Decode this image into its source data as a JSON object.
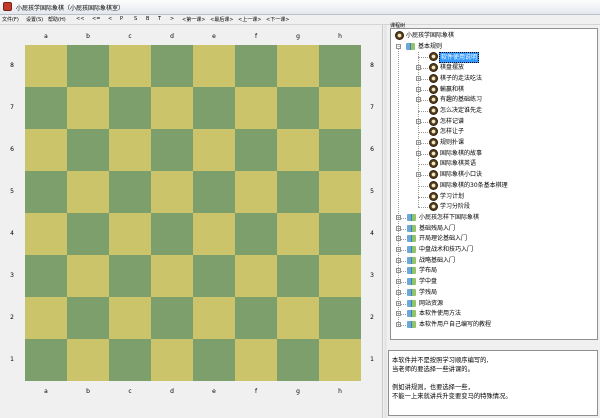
{
  "window": {
    "title": "小屁孩学国际象棋（小屁孩国际象棋室）"
  },
  "menu": [
    "文件(F)",
    "设置(S)",
    "帮助(H)",
    "<<",
    "<=",
    "<",
    "P",
    "S",
    "B",
    "T",
    ">",
    "<第一课>",
    "<最后课>",
    "<上一课>",
    "<下一课>"
  ],
  "board": {
    "files": [
      "a",
      "b",
      "c",
      "d",
      "e",
      "f",
      "g",
      "h"
    ],
    "ranks": [
      "8",
      "7",
      "6",
      "5",
      "4",
      "3",
      "2",
      "1"
    ],
    "colors": {
      "light": "#cbc46b",
      "dark": "#7c9f6b"
    }
  },
  "tree": {
    "caption": "课程树",
    "root": "小屁孩学国际象棋",
    "basic": "基本规则",
    "selected": "软件使用说明",
    "basic_items": [
      {
        "label": "软件使用说明",
        "expandable": false
      },
      {
        "label": "棋盘摆放",
        "expandable": true
      },
      {
        "label": "棋子的走法吃法",
        "expandable": true
      },
      {
        "label": "輸赢和棋",
        "expandable": true
      },
      {
        "label": "有趣的基础练习",
        "expandable": true
      },
      {
        "label": "怎么决定谁先走",
        "expandable": false
      },
      {
        "label": "怎样记谱",
        "expandable": true
      },
      {
        "label": "怎样让子",
        "expandable": false
      },
      {
        "label": "规则扑课",
        "expandable": true
      },
      {
        "label": "国际象棋的故事",
        "expandable": true
      },
      {
        "label": "国际象棋英语",
        "expandable": false
      },
      {
        "label": "国际象棋小口诀",
        "expandable": true
      },
      {
        "label": "国际象棋的30条基本棋理",
        "expandable": false
      },
      {
        "label": "学习计划",
        "expandable": false
      },
      {
        "label": "学习分阶段",
        "expandable": false
      }
    ],
    "sections": [
      "小屁孩怎样下国际象棋",
      "基础残局入门",
      "开局理论基础入门",
      "中盘战术和技巧入门",
      "战略基础入门",
      "学布局",
      "学中盘",
      "学残局",
      "网站资源",
      "本软件使用方法",
      "本软件用户自己编写的教程"
    ]
  },
  "description": {
    "lines": [
      "本软件并不是按照学习顺序编写的,",
      "当老师的要选择一些讲课的。",
      "",
      "例如讲规则，也要选择一些，",
      "不能一上来就讲兵升变要变马的特殊情况。"
    ]
  }
}
